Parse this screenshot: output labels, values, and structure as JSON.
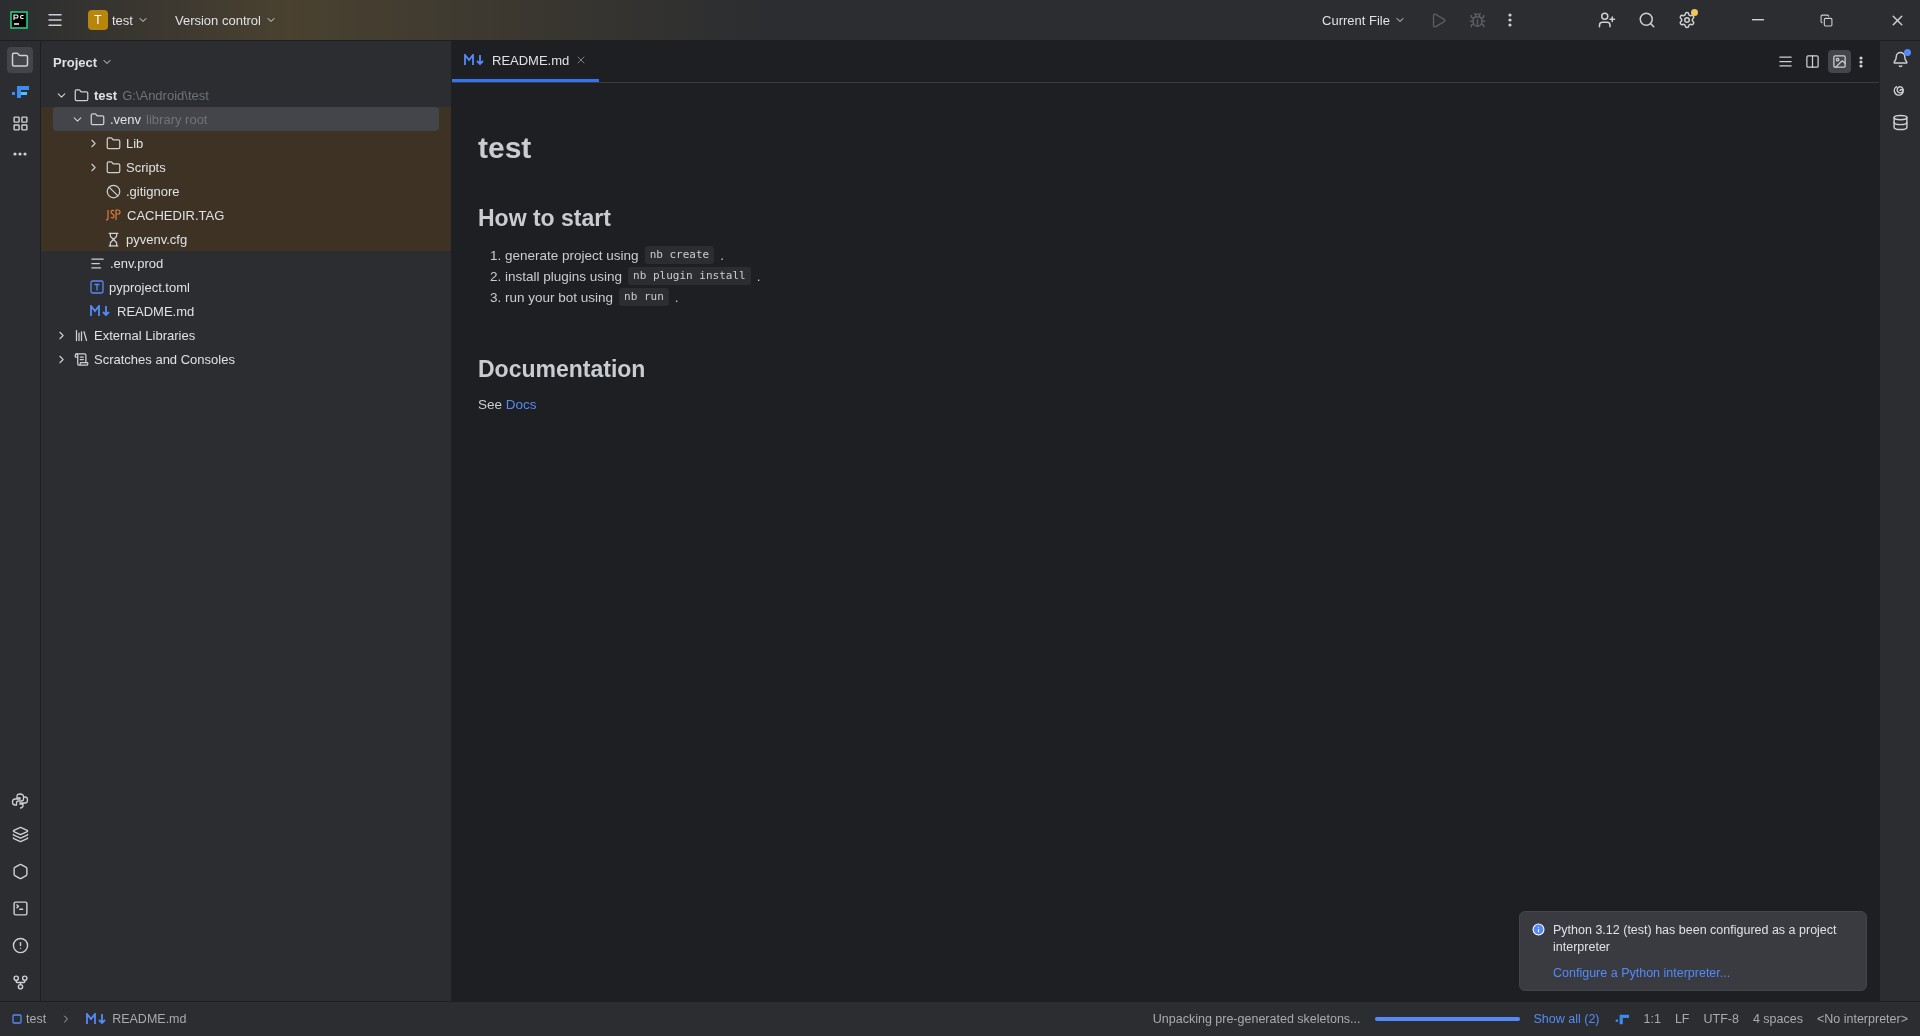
{
  "title_bar": {
    "project_initial": "T",
    "project_name": "test",
    "vcs_menu": "Version control",
    "run_config": "Current File"
  },
  "project_panel": {
    "title": "Project",
    "tree": [
      {
        "label": "test",
        "hint": "G:\\Android\\test",
        "kind": "folder",
        "bold": true,
        "expanded": true,
        "selected": false,
        "highlighted": false,
        "children": [
          {
            "label": ".venv",
            "hint": "library root",
            "kind": "folder",
            "expanded": true,
            "selected": true,
            "highlighted": true,
            "children": [
              {
                "label": "Lib",
                "kind": "folder",
                "expanded": false,
                "selected": false,
                "highlighted": true
              },
              {
                "label": "Scripts",
                "kind": "folder",
                "expanded": false,
                "selected": false,
                "highlighted": true
              },
              {
                "label": ".gitignore",
                "kind": "ignore",
                "selected": false,
                "highlighted": true
              },
              {
                "label": "CACHEDIR.TAG",
                "kind": "tag",
                "selected": false,
                "highlighted": true
              },
              {
                "label": "pyvenv.cfg",
                "kind": "config",
                "selected": false,
                "highlighted": true
              }
            ]
          },
          {
            "label": ".env.prod",
            "kind": "text",
            "selected": false,
            "highlighted": false
          },
          {
            "label": "pyproject.toml",
            "kind": "toml",
            "selected": false,
            "highlighted": false
          },
          {
            "label": "README.md",
            "kind": "markdown",
            "selected": false,
            "highlighted": false
          }
        ]
      },
      {
        "label": "External Libraries",
        "kind": "library",
        "expanded": false,
        "selected": false,
        "highlighted": false
      },
      {
        "label": "Scratches and Consoles",
        "kind": "scratches",
        "expanded": false,
        "selected": false,
        "highlighted": false
      }
    ]
  },
  "editor": {
    "tabs": [
      {
        "label": "README.md",
        "selected": true
      }
    ],
    "view_modes": [
      {
        "kind": "editor",
        "selected": false
      },
      {
        "kind": "split",
        "selected": false
      },
      {
        "kind": "preview",
        "selected": true
      }
    ],
    "document": {
      "title": "test",
      "sections": [
        {
          "heading": "How to start",
          "steps": [
            {
              "marker": "1.",
              "text": "generate project using",
              "code": "nb create",
              "end": "."
            },
            {
              "marker": "2.",
              "text": "install plugins using",
              "code": "nb plugin install",
              "end": "."
            },
            {
              "marker": "3.",
              "text": "run your bot using",
              "code": "nb run",
              "end": "."
            }
          ]
        },
        {
          "heading": "Documentation",
          "prefix": "See",
          "link": "Docs"
        }
      ]
    }
  },
  "notification": {
    "message": "Python 3.12 (test) has been configured as a project interpreter",
    "action": "Configure a Python interpreter..."
  },
  "status_bar": {
    "breadcrumbs": [
      "test",
      "README.md"
    ],
    "progress_text": "Unpacking pre-generated skeletons...",
    "progress": {
      "level": 1
    },
    "show_all": "Show all (2)",
    "position": "1:1",
    "line_separator": "LF",
    "encoding": "UTF-8",
    "indent": "4 spaces",
    "interpreter": "<No interpreter>"
  }
}
